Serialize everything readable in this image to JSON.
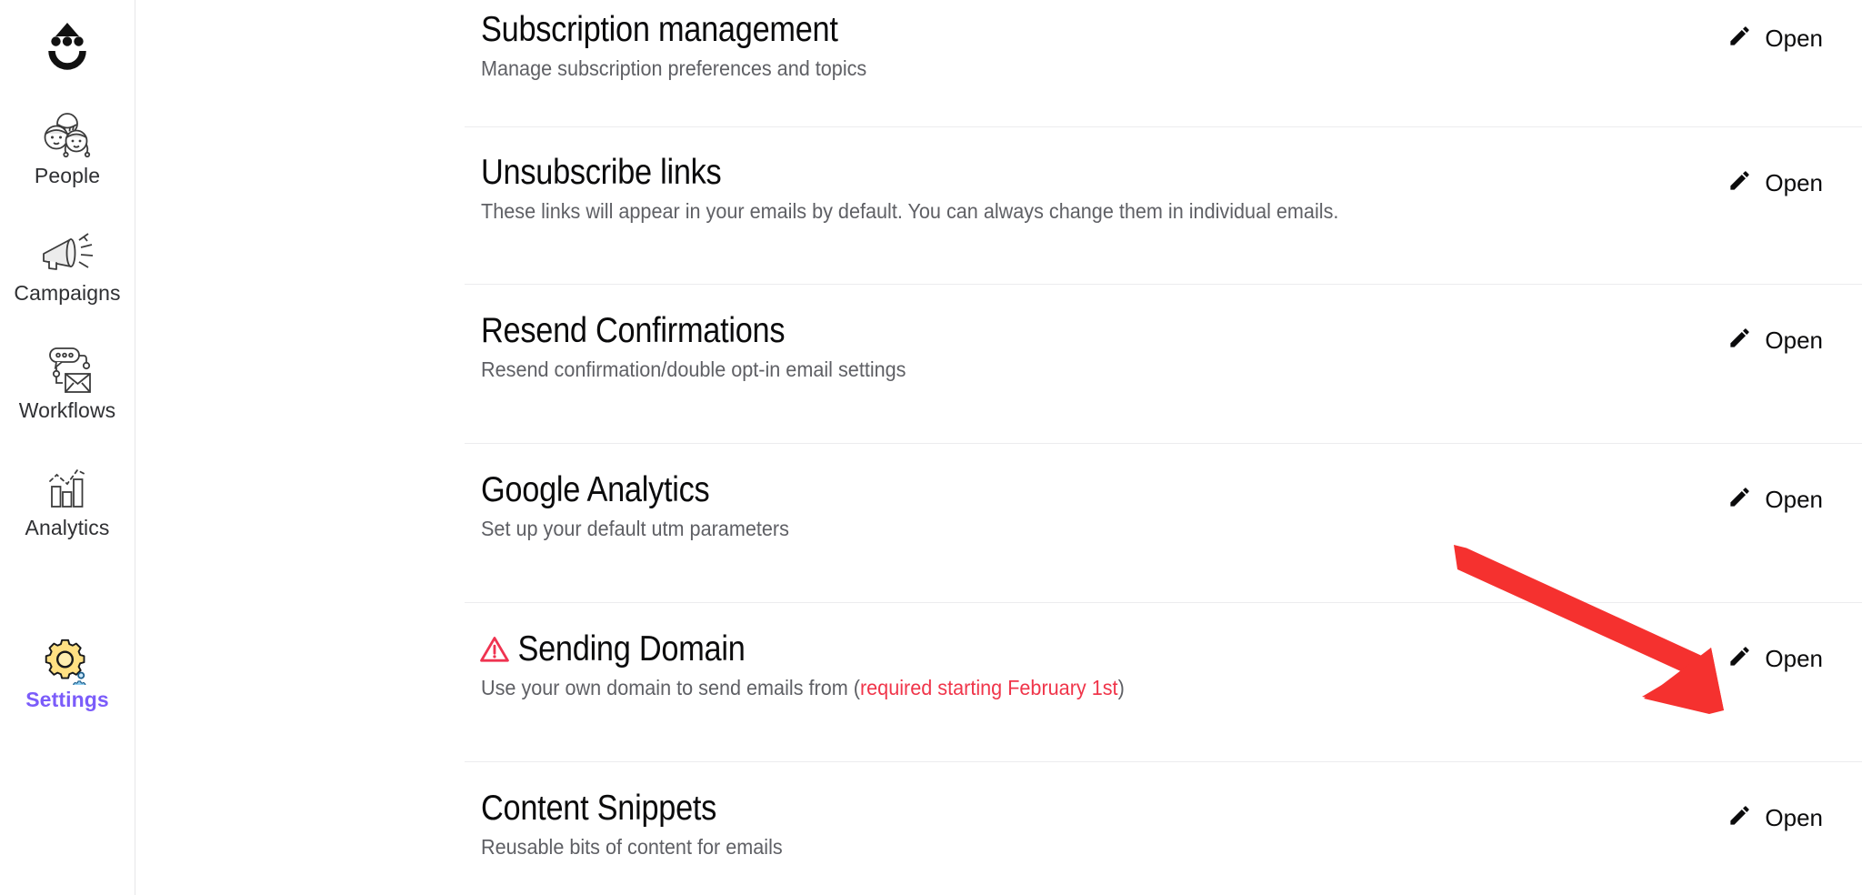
{
  "sidebar": {
    "logo_icon": "smiley-face-logo",
    "items": [
      {
        "id": "people",
        "label": "People",
        "icon": "people-icon",
        "active": false
      },
      {
        "id": "campaigns",
        "label": "Campaigns",
        "icon": "megaphone-icon",
        "active": false
      },
      {
        "id": "workflows",
        "label": "Workflows",
        "icon": "workflow-mail-icon",
        "active": false
      },
      {
        "id": "analytics",
        "label": "Analytics",
        "icon": "bar-chart-icon",
        "active": false
      },
      {
        "id": "settings",
        "label": "Settings",
        "icon": "gear-icon",
        "active": true
      }
    ],
    "active_color": "#7b5cfa"
  },
  "main": {
    "rows": [
      {
        "id": "subscription-management",
        "title": "Subscription management",
        "subtitle": "Manage subscription preferences and topics",
        "warning": false,
        "action_label": "Open",
        "action_icon": "pencil-icon"
      },
      {
        "id": "unsubscribe-links",
        "title": "Unsubscribe links",
        "subtitle": "These links will appear in your emails by default. You can always change them in individual emails.",
        "warning": false,
        "action_label": "Open",
        "action_icon": "pencil-icon"
      },
      {
        "id": "resend-confirmations",
        "title": "Resend Confirmations",
        "subtitle": "Resend confirmation/double opt-in email settings",
        "warning": false,
        "action_label": "Open",
        "action_icon": "pencil-icon"
      },
      {
        "id": "google-analytics",
        "title": "Google Analytics",
        "subtitle": "Set up your default utm parameters",
        "warning": false,
        "action_label": "Open",
        "action_icon": "pencil-icon"
      },
      {
        "id": "sending-domain",
        "title": "Sending Domain",
        "subtitle_prefix": "Use your own domain to send emails from (",
        "subtitle_accent": "required starting February 1st",
        "subtitle_suffix": ")",
        "warning": true,
        "warning_icon": "warning-triangle-icon",
        "warning_color": "#ef3350",
        "action_label": "Open",
        "action_icon": "pencil-icon"
      },
      {
        "id": "content-snippets",
        "title": "Content Snippets",
        "subtitle": "Reusable bits of content for emails",
        "warning": false,
        "action_label": "Open",
        "action_icon": "pencil-icon"
      }
    ]
  },
  "annotation": {
    "arrow_icon": "red-arrow-pointer",
    "color": "#f5312f",
    "points_to": "sending-domain-open-button"
  }
}
